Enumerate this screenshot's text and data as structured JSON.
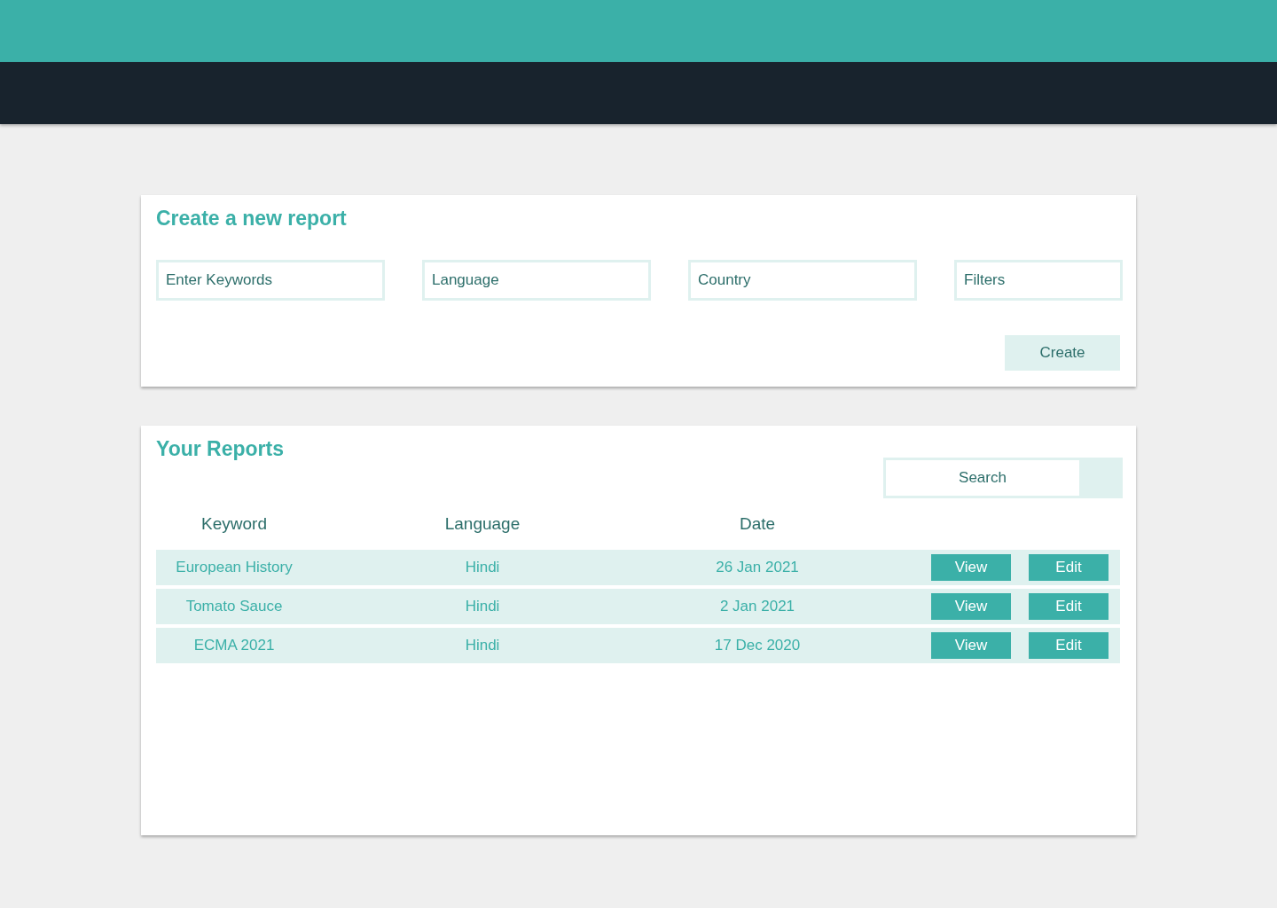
{
  "create_report": {
    "title": "Create a new report",
    "fields": [
      {
        "placeholder": "Enter Keywords"
      },
      {
        "placeholder": "Language"
      },
      {
        "placeholder": "Country"
      },
      {
        "placeholder": "Filters"
      }
    ],
    "create_button": "Create"
  },
  "reports": {
    "title": "Your Reports",
    "search": {
      "placeholder": "Search"
    },
    "columns": [
      "Keyword",
      "Language",
      "Date"
    ],
    "rows": [
      {
        "keyword": "European History",
        "language": "Hindi",
        "date": "26 Jan 2021",
        "actions": [
          "View",
          "Edit"
        ]
      },
      {
        "keyword": "Tomato Sauce",
        "language": "Hindi",
        "date": "2 Jan 2021",
        "actions": [
          "View",
          "Edit"
        ]
      },
      {
        "keyword": "ECMA 2021",
        "language": "Hindi",
        "date": "17 Dec 2020",
        "actions": [
          "View",
          "Edit"
        ]
      }
    ]
  }
}
